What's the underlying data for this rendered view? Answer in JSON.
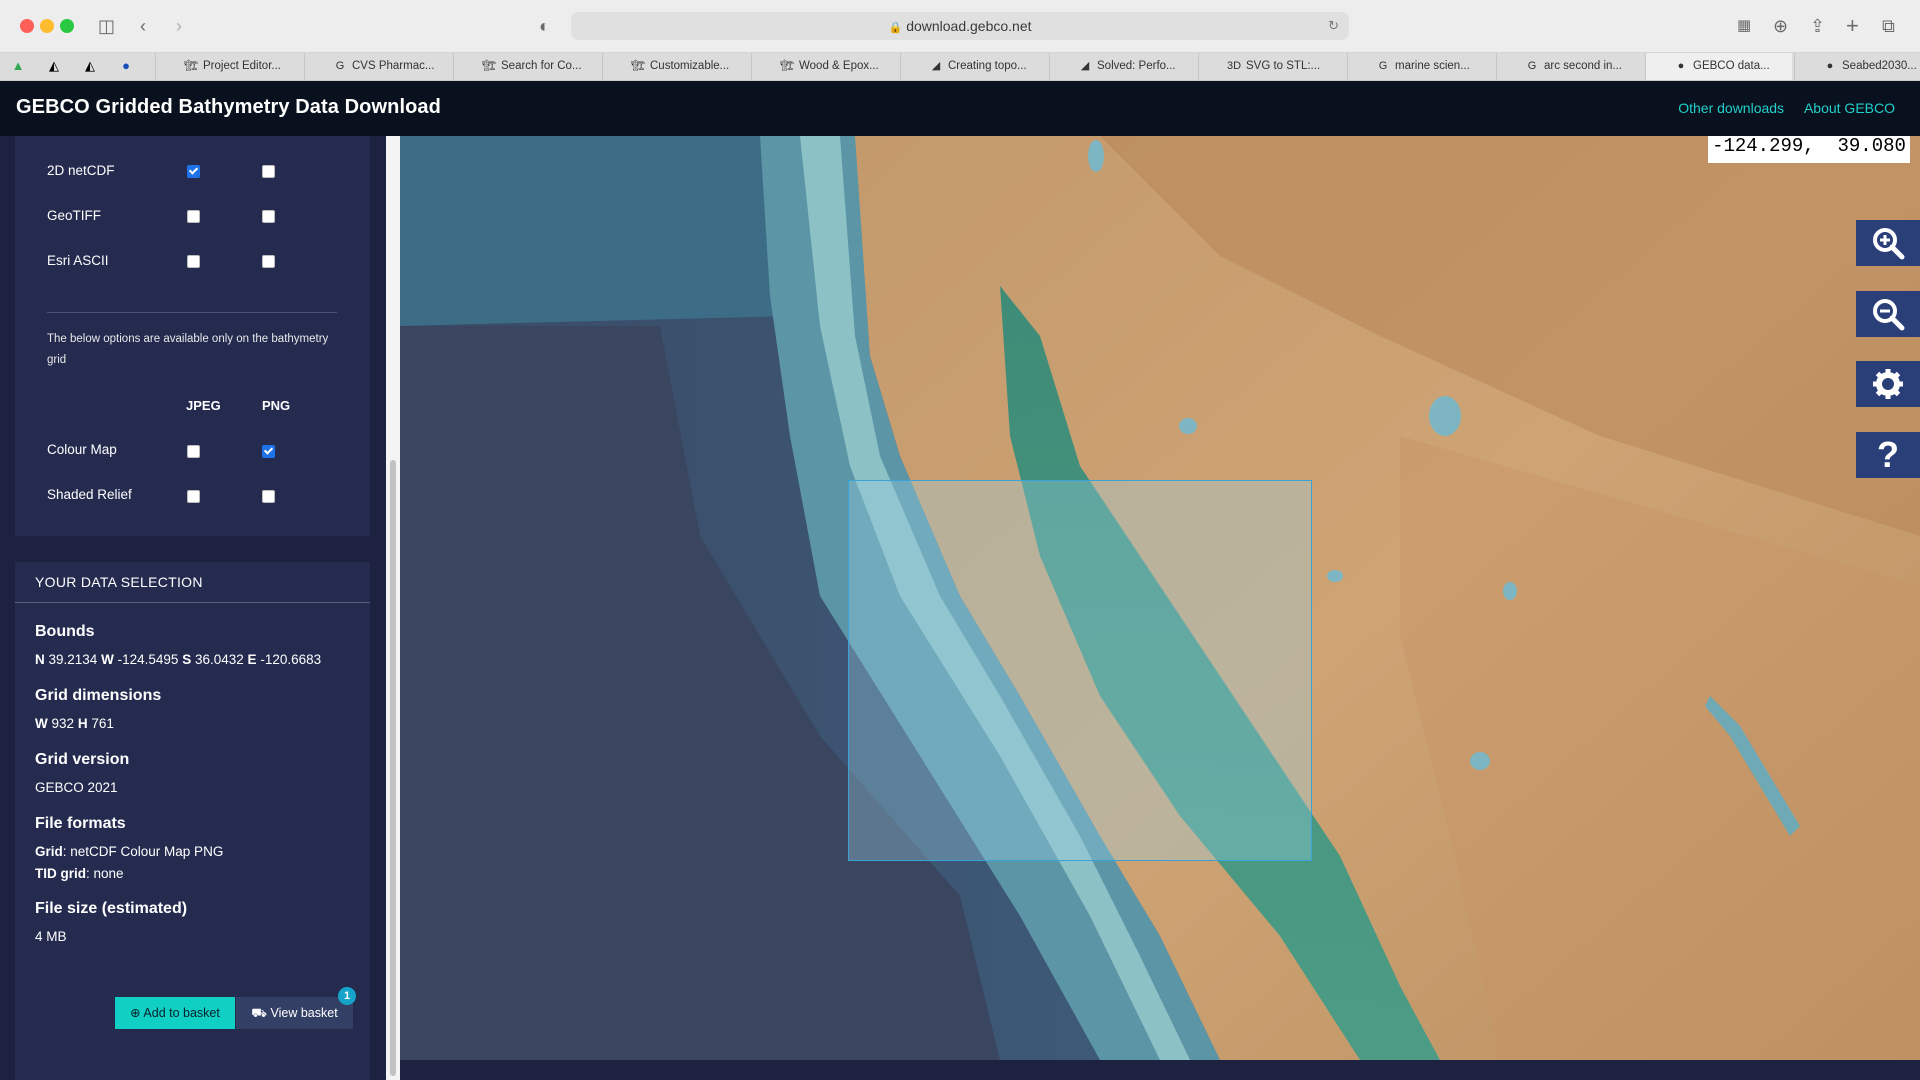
{
  "browser": {
    "url": "download.gebco.net",
    "tabs": [
      {
        "label": "Project Editor...",
        "icon": "🏗"
      },
      {
        "label": "CVS Pharmac...",
        "icon": "G"
      },
      {
        "label": "Search for Co...",
        "icon": "🏗"
      },
      {
        "label": "Customizable...",
        "icon": "🏗"
      },
      {
        "label": "Wood & Epox...",
        "icon": "🏗"
      },
      {
        "label": "Creating topo...",
        "icon": "◢"
      },
      {
        "label": "Solved: Perfo...",
        "icon": "◢"
      },
      {
        "label": "SVG to STL:...",
        "icon": "3D"
      },
      {
        "label": "marine scien...",
        "icon": "G"
      },
      {
        "label": "arc second in...",
        "icon": "G"
      },
      {
        "label": "GEBCO data...",
        "icon": "●",
        "active": true
      },
      {
        "label": "Seabed2030...",
        "icon": "●"
      }
    ]
  },
  "header": {
    "title": "GEBCO Gridded Bathymetry Data Download",
    "nav": [
      "Other downloads",
      "About GEBCO"
    ]
  },
  "formats": {
    "grid_rows": [
      {
        "label": "2D netCDF",
        "grid": true,
        "tid": false
      },
      {
        "label": "GeoTIFF",
        "grid": false,
        "tid": false
      },
      {
        "label": "Esri ASCII",
        "grid": false,
        "tid": false
      }
    ],
    "note": "The below options are available only on the bathymetry grid",
    "image_headers": [
      "JPEG",
      "PNG"
    ],
    "image_rows": [
      {
        "label": "Colour Map",
        "jpeg": false,
        "png": true
      },
      {
        "label": "Shaded Relief",
        "jpeg": false,
        "png": false
      }
    ]
  },
  "selection": {
    "title": "YOUR DATA SELECTION",
    "bounds_heading": "Bounds",
    "bounds": {
      "N": "39.2134",
      "W": "-124.5495",
      "S": "36.0432",
      "E": "-120.6683"
    },
    "grid_dim_heading": "Grid dimensions",
    "grid_w": "932",
    "grid_h": "761",
    "grid_version_heading": "Grid version",
    "grid_version": "GEBCO 2021",
    "file_formats_heading": "File formats",
    "grid_label": "Grid",
    "grid_formats": ": netCDF Colour Map PNG",
    "tid_label": "TID grid",
    "tid_formats": ": none",
    "file_size_heading": "File size (estimated)",
    "file_size": "4 MB"
  },
  "buttons": {
    "add_basket": "Add to basket",
    "view_basket": "View basket",
    "basket_count": "1"
  },
  "map": {
    "coords": "-124.299,  39.080",
    "controls": [
      "zoom-in",
      "zoom-out",
      "settings",
      "help"
    ]
  }
}
